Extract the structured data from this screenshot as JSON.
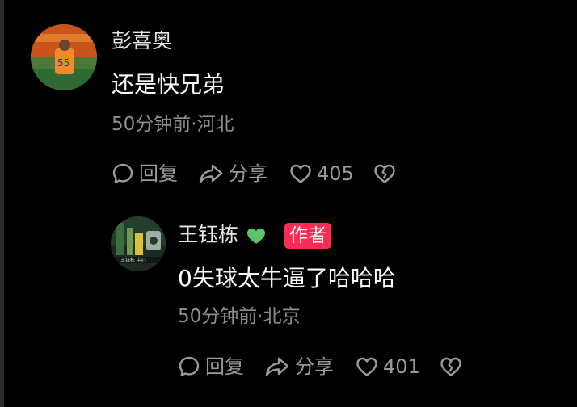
{
  "comment": {
    "author": "彭喜奥",
    "text": "还是快兄弟",
    "time": "50分钟前",
    "location": "河北",
    "reply_label": "回复",
    "share_label": "分享",
    "like_count": "405"
  },
  "reply": {
    "author": "王钰栋",
    "author_badge": "作者",
    "text": "0失球太牛逼了哈哈哈",
    "time": "50分钟前",
    "location": "北京",
    "reply_label": "回复",
    "share_label": "分享",
    "like_count": "401"
  },
  "colors": {
    "background": "#000000",
    "author_badge": "#fe2c55",
    "verified_heart": "#5ec26a",
    "muted_text": "#8c8c8c"
  },
  "icons": [
    "comment-bubble-icon",
    "share-arrow-icon",
    "heart-icon",
    "broken-heart-icon",
    "green-heart-icon"
  ]
}
